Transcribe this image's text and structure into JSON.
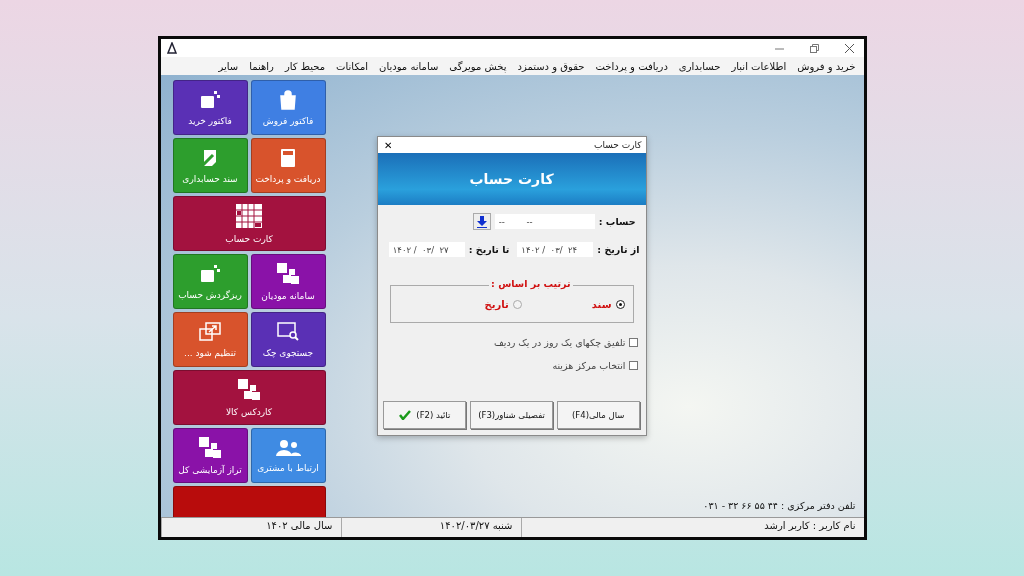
{
  "menu": [
    "خرید و فروش",
    "اطلاعات انبار",
    "حسابداری",
    "دریافت و پرداخت",
    "حقوق و دستمزد",
    "پخش مویرگی",
    "سامانه مودیان",
    "امکانات",
    "محیط کار",
    "راهنما",
    "سایر"
  ],
  "tiles": [
    {
      "label": "فاکتور فروش",
      "color": "#3f7fe3",
      "kind": "square"
    },
    {
      "label": "فاکتور خرید",
      "color": "#5a30b5",
      "kind": "square"
    },
    {
      "label": "دریافت و پرداخت",
      "color": "#d8532c",
      "kind": "square"
    },
    {
      "label": "سند حسابداری",
      "color": "#2d9e2d",
      "kind": "square"
    },
    {
      "label": "کارت حساب",
      "color": "#a3123f",
      "kind": "wide"
    },
    {
      "label": "سامانه مودیان",
      "color": "#8a12a8",
      "kind": "square"
    },
    {
      "label": "ریزگردش حساب",
      "color": "#2d9e2d",
      "kind": "square"
    },
    {
      "label": "جستجوی چک",
      "color": "#5a30b5",
      "kind": "square"
    },
    {
      "label": "تنظیم شود ...",
      "color": "#d8532c",
      "kind": "square"
    },
    {
      "label": "کاردکس کالا",
      "color": "#a3123f",
      "kind": "wide"
    },
    {
      "label": "ارتباط با مشتری",
      "color": "#3f8be3",
      "kind": "square"
    },
    {
      "label": "تراز آزمایشی کل",
      "color": "#8a12a8",
      "kind": "square"
    },
    {
      "color": "#b80c0c",
      "kind": "wide"
    }
  ],
  "dialog": {
    "title": "کارت حساب",
    "close": "✕",
    "header": "کارت حساب",
    "account": {
      "label": "حساب :",
      "value": "--        --"
    },
    "from_date": {
      "label": "از تاریخ :",
      "value": "۱۴۰۲ /  ۰۳/  ۲۴"
    },
    "to_date": {
      "label": "تا تاریخ :",
      "value": "۱۴۰۲ /  ۰۳/  ۲۷"
    },
    "sort": {
      "legend": "ترتیب بر اساس :",
      "options": [
        {
          "label": "سند",
          "selected": true
        },
        {
          "label": "تاریخ",
          "selected": false
        }
      ]
    },
    "checkboxes": [
      {
        "label": "تلفیق چکهای یک روز در یک ردیف",
        "checked": false
      },
      {
        "label": "انتخاب مرکز هزینه",
        "checked": false
      }
    ],
    "buttons": [
      {
        "label": "سال مالی(F4)",
        "kind": "plain"
      },
      {
        "label": "تفصیلی شناور(F3)",
        "kind": "plain"
      },
      {
        "label": "تائید (F2)",
        "kind": "confirm"
      }
    ]
  },
  "phone": {
    "label": "تلفن دفتر مرکزی  :",
    "value": "۰۳۱ - ۳۲ ۶۶ ۵۵ ۴۴"
  },
  "status_bar": [
    "نام کاربر : کاربر ارشد",
    "شنبه  ۱۴۰۲/۰۳/۲۷",
    "سال مالی ۱۴۰۲"
  ]
}
